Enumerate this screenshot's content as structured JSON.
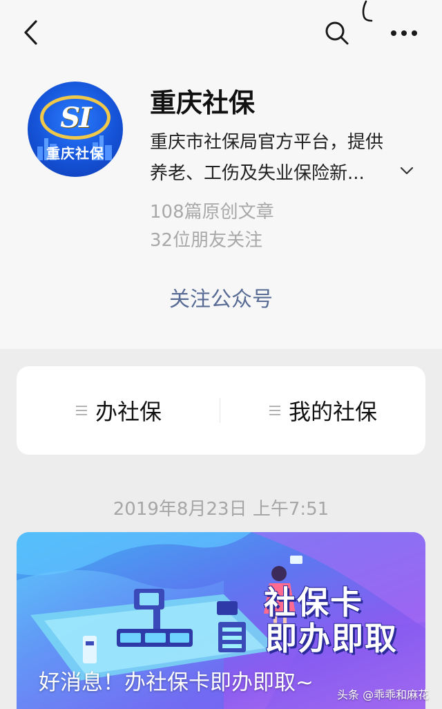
{
  "nav": {
    "back_icon": "chevron-left-icon",
    "search_icon": "search-icon",
    "more_icon": "more-dots-icon"
  },
  "account": {
    "avatar_logo_text": "SI",
    "avatar_label": "重庆社保",
    "name": "重庆社保",
    "description_line1": "重庆市社保局官方平台，提供",
    "description_line2": "养老、工伤及失业保险新...",
    "expand_icon": "chevron-down-icon",
    "original_articles": "108篇原创文章",
    "friends_following": "32位朋友关注",
    "follow_label": "关注公众号",
    "link_color": "#576b95"
  },
  "menu": {
    "items": [
      {
        "label": "办社保",
        "icon": "hamburger-icon"
      },
      {
        "label": "我的社保",
        "icon": "hamburger-icon"
      }
    ]
  },
  "feed": {
    "timestamp": "2019年8月23日 上午7:51",
    "article": {
      "banner_line1": "社保卡",
      "banner_line2": "即办即取",
      "title": "好消息！办社保卡即办即取~"
    }
  },
  "watermark": "头条 @乖乖和麻花"
}
